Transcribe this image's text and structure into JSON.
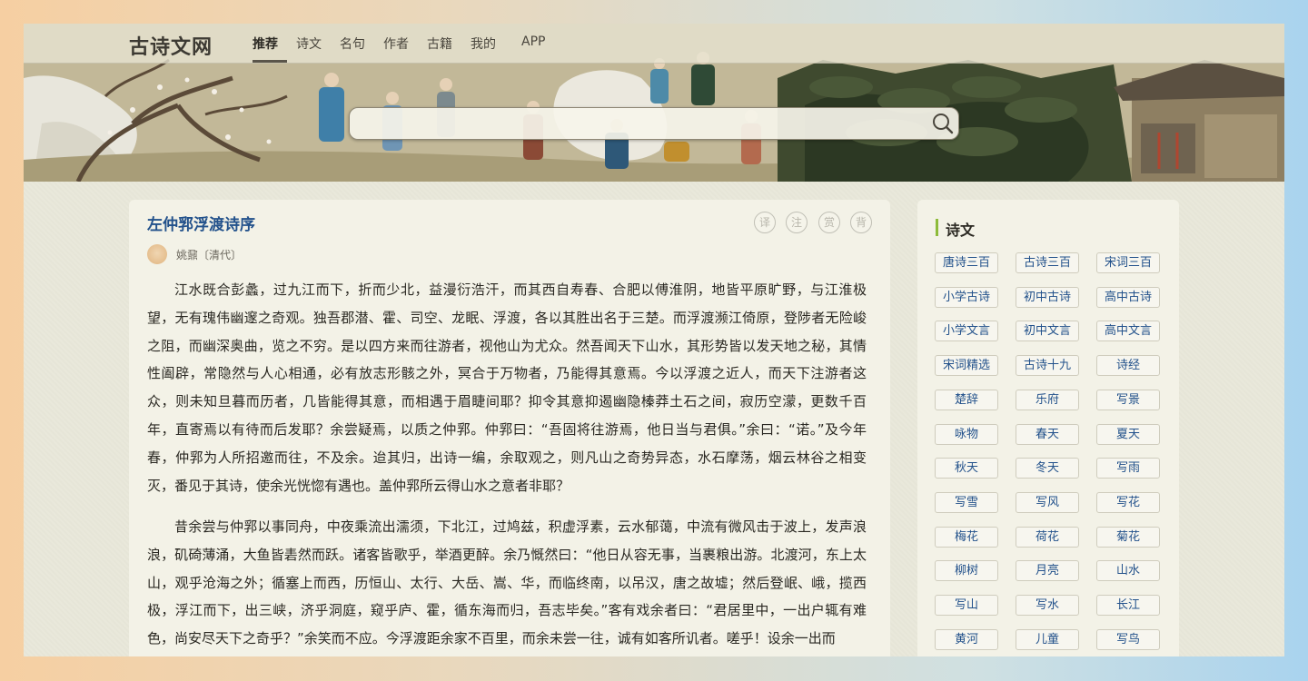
{
  "site": {
    "logo": "古诗文网"
  },
  "nav": [
    "推荐",
    "诗文",
    "名句",
    "作者",
    "古籍",
    "我的",
    "APP"
  ],
  "search": {
    "placeholder": ""
  },
  "article": {
    "title": "左仲郛浮渡诗序",
    "actions": [
      "译",
      "注",
      "赏",
      "背"
    ],
    "author": "姚鼐〔清代〕",
    "paragraphs": [
      "江水既合彭蠡，过九江而下，折而少北，益漫衍浩汗，而其西自寿春、合肥以傅淮阴，地皆平原旷野，与江淮极望，无有瑰伟幽邃之奇观。独吾郡潜、霍、司空、龙眠、浮渡，各以其胜出名于三楚。而浮渡濒江倚原，登陟者无险峻之阻，而幽深奥曲，览之不穷。是以四方来而往游者，视他山为尤众。然吾闻天下山水，其形势皆以发天地之秘，其情性阖辟，常隐然与人心相通，必有放志形骸之外，冥合于万物者，乃能得其意焉。今以浮渡之近人，而天下注游者这众，则未知旦暮而历者，几皆能得其意，而相遇于眉睫间耶？抑令其意抑遏幽隐榛莽土石之间，寂历空濛，更数千百年，直寄焉以有待而后发耶？余尝疑焉，以质之仲郛。仲郛曰：“吾固将往游焉，他日当与君俱。”余曰：“诺。”及今年春，仲郛为人所招邀而往，不及余。迨其归，出诗一编，余取观之，则凡山之奇势异态，水石摩荡，烟云林谷之相变灭，番见于其诗，使余光恍惚有遇也。盖仲郛所云得山水之意者非耶？",
      "昔余尝与仲郛以事同舟，中夜乘流出濡须，下北江，过鸠兹，积虚浮素，云水郁蔼，中流有微风击于波上，发声浪浪，矶碕薄涌，大鱼皆砉然而跃。诸客皆歌乎，举酒更醉。余乃慨然曰：“他日从容无事，当裹粮出游。北渡河，东上太山，观乎沧海之外；循塞上而西，历恒山、太行、大岳、嵩、华，而临终南，以吊汉，唐之故墟；然后登岷、峨，揽西极，浮江而下，出三峡，济乎洞庭，窥乎庐、霍，循东海而归，吾志毕矣。”客有戏余者曰：“君居里中，一出户辄有难色，尚安尽天下之奇乎？”余笑而不应。今浮渡距余家不百里，而余未尝一往，诚有如客所讥者。嗟乎！设余一出而"
    ]
  },
  "sidebar": {
    "title": "诗文",
    "tags": [
      "唐诗三百",
      "古诗三百",
      "宋词三百",
      "小学古诗",
      "初中古诗",
      "高中古诗",
      "小学文言",
      "初中文言",
      "高中文言",
      "宋词精选",
      "古诗十九",
      "诗经",
      "楚辞",
      "乐府",
      "写景",
      "咏物",
      "春天",
      "夏天",
      "秋天",
      "冬天",
      "写雨",
      "写雪",
      "写风",
      "写花",
      "梅花",
      "荷花",
      "菊花",
      "柳树",
      "月亮",
      "山水",
      "写山",
      "写水",
      "长江",
      "黄河",
      "儿童",
      "写鸟"
    ]
  },
  "colors": {
    "title_blue": "#22518b",
    "tag_blue": "#22518b",
    "accent_green": "#8dbb3a",
    "panel_bg": "#f3f2e7",
    "page_bg": "#e9e8da"
  },
  "icons": {
    "search": "search-icon",
    "avatar": "author-avatar"
  }
}
